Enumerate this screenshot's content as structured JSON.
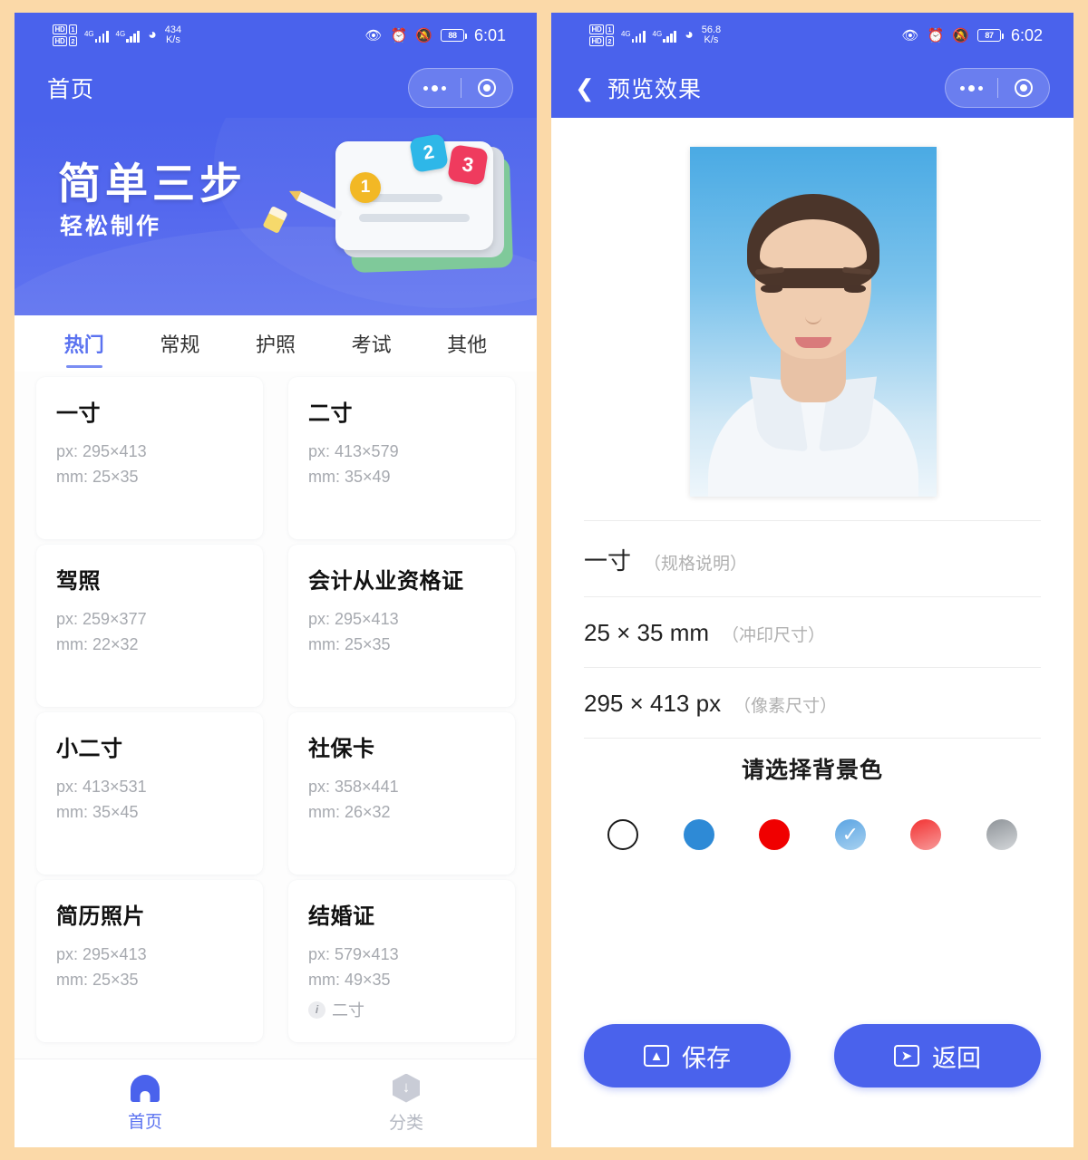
{
  "left": {
    "statusbar": {
      "hd1_label": "HD",
      "hd1_num": "1",
      "hd2_label": "HD",
      "hd2_num": "2",
      "net1": "4G",
      "net2": "4G",
      "wifi_icon": "wifi-icon",
      "speed_value": "434",
      "speed_unit": "K/s",
      "eye_icon": "eye-icon",
      "alarm_icon": "alarm-clock-icon",
      "mute_icon": "bell-muted-icon",
      "battery": "88",
      "time": "6:01"
    },
    "navbar": {
      "title": "首页",
      "more_icon": "more-dots-icon",
      "target_icon": "target-circle-icon"
    },
    "banner": {
      "title": "简单三步",
      "subtitle": "轻松制作",
      "badges": [
        "1",
        "2",
        "3"
      ],
      "eraser_icon": "eraser-icon",
      "pencil_icon": "pencil-icon"
    },
    "tabs": [
      {
        "label": "热门",
        "active": true
      },
      {
        "label": "常规",
        "active": false
      },
      {
        "label": "护照",
        "active": false
      },
      {
        "label": "考试",
        "active": false
      },
      {
        "label": "其他",
        "active": false
      }
    ],
    "cards": [
      {
        "title": "一寸",
        "px": "px: 295×413",
        "mm": "mm: 25×35",
        "note": ""
      },
      {
        "title": "二寸",
        "px": "px: 413×579",
        "mm": "mm: 35×49",
        "note": ""
      },
      {
        "title": "驾照",
        "px": "px: 259×377",
        "mm": "mm: 22×32",
        "note": ""
      },
      {
        "title": "会计从业资格证",
        "px": "px: 295×413",
        "mm": "mm: 25×35",
        "note": ""
      },
      {
        "title": "小二寸",
        "px": "px: 413×531",
        "mm": "mm: 35×45",
        "note": ""
      },
      {
        "title": "社保卡",
        "px": "px: 358×441",
        "mm": "mm: 26×32",
        "note": ""
      },
      {
        "title": "简历照片",
        "px": "px: 295×413",
        "mm": "mm: 25×35",
        "note": ""
      },
      {
        "title": "结婚证",
        "px": "px: 579×413",
        "mm": "mm: 49×35",
        "note": "二寸"
      }
    ],
    "bottom_tabs": [
      {
        "label": "首页",
        "icon": "home-icon",
        "active": true
      },
      {
        "label": "分类",
        "icon": "category-icon",
        "active": false
      }
    ]
  },
  "right": {
    "statusbar": {
      "hd1_label": "HD",
      "hd1_num": "1",
      "hd2_label": "HD",
      "hd2_num": "2",
      "net1": "4G",
      "net2": "4G",
      "wifi_icon": "wifi-icon",
      "speed_value": "56.8",
      "speed_unit": "K/s",
      "eye_icon": "eye-icon",
      "alarm_icon": "alarm-clock-icon",
      "mute_icon": "bell-muted-icon",
      "battery": "87",
      "time": "6:02"
    },
    "navbar": {
      "back_icon": "chevron-left-icon",
      "title": "预览效果",
      "more_icon": "more-dots-icon",
      "target_icon": "target-circle-icon"
    },
    "photo": {
      "alt": "id-photo-preview"
    },
    "info_rows": [
      {
        "main": "一寸",
        "note": "（规格说明）"
      },
      {
        "main": "25 × 35 mm",
        "note": "（冲印尺寸）"
      },
      {
        "main": "295 × 413 px",
        "note": "（像素尺寸）"
      }
    ],
    "bg_section": {
      "title": "请选择背景色",
      "swatches": [
        {
          "name": "swatch-white",
          "color": "#ffffff",
          "gradient": "",
          "outlined": true,
          "selected": false
        },
        {
          "name": "swatch-blue-solid",
          "color": "#2e8ad6",
          "gradient": "",
          "outlined": false,
          "selected": false
        },
        {
          "name": "swatch-red-solid",
          "color": "#f00000",
          "gradient": "",
          "outlined": false,
          "selected": false
        },
        {
          "name": "swatch-blue-gradient",
          "color": "#6cb0e8",
          "gradient": "linear-gradient(160deg,#5ba4e3 0%,#a7d1f0 100%)",
          "outlined": false,
          "selected": true
        },
        {
          "name": "swatch-red-gradient",
          "color": "#ef4444",
          "gradient": "linear-gradient(160deg,#f23232 0%,#f89a9a 100%)",
          "outlined": false,
          "selected": false
        },
        {
          "name": "swatch-gray-gradient",
          "color": "#9ea3a8",
          "gradient": "linear-gradient(160deg,#8e9398 0%,#d4d7da 100%)",
          "outlined": false,
          "selected": false
        }
      ],
      "check_icon": "check-icon"
    },
    "actions": [
      {
        "label": "保存",
        "icon": "image-icon",
        "glyph": "▨"
      },
      {
        "label": "返回",
        "icon": "share-arrow-icon",
        "glyph": "➦"
      }
    ]
  },
  "theme": {
    "page_bg": "#fbd9a8",
    "brand_blue": "#4a62ec",
    "accent_blue": "#5a72f0",
    "card_bg": "#ffffff",
    "muted_text": "#a6a9af"
  }
}
